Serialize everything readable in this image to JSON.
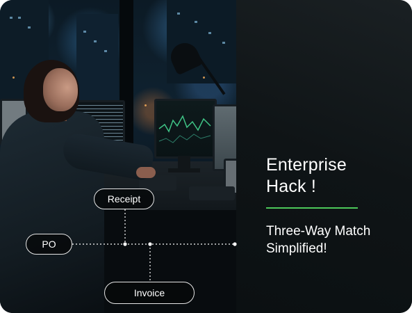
{
  "headline": "Enterprise\nHack !",
  "subheadline": "Three-Way Match\nSimplified!",
  "accent_color": "#4cc85a",
  "diagram": {
    "receipt": "Receipt",
    "po": "PO",
    "invoice": "Invoice"
  }
}
